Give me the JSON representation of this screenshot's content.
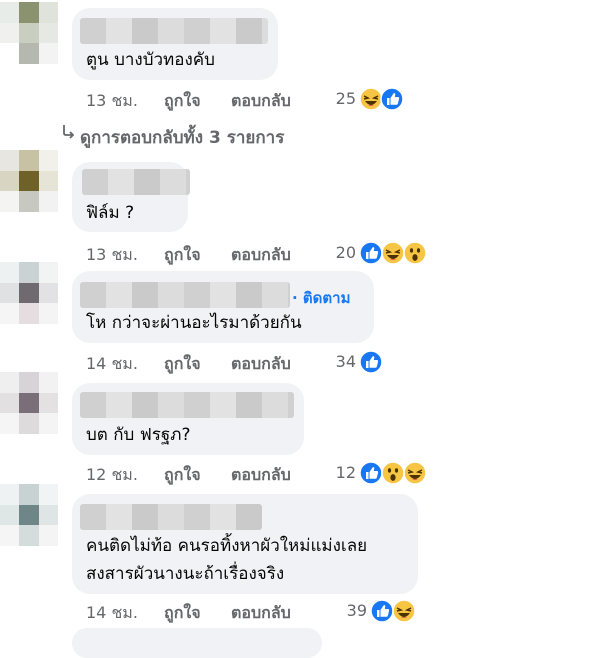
{
  "comments": [
    {
      "text": "ตูน บางบัวทองคับ",
      "time": "13 ชม.",
      "like": "ถูกใจ",
      "reply": "ตอบกลับ",
      "reactions_count": "25",
      "reactions": [
        "haha-icon",
        "like-icon"
      ]
    },
    {
      "text": "ฟิล์ม ?",
      "time": "13 ชม.",
      "like": "ถูกใจ",
      "reply": "ตอบกลับ",
      "reactions_count": "20",
      "reactions": [
        "like-icon",
        "haha-icon",
        "wow-icon"
      ]
    },
    {
      "text": "โห กว่าจะผ่านอะไรมาด้วยกัน",
      "follow": "· ติดตาม",
      "time": "14 ชม.",
      "like": "ถูกใจ",
      "reply": "ตอบกลับ",
      "reactions_count": "34",
      "reactions": [
        "like-icon"
      ]
    },
    {
      "text": "บต กับ ฟรฐภ?",
      "time": "12 ชม.",
      "like": "ถูกใจ",
      "reply": "ตอบกลับ",
      "reactions_count": "12",
      "reactions": [
        "like-icon",
        "wow-icon",
        "haha-icon"
      ]
    },
    {
      "text_line1": "คนติดไม่ท้อ คนรอทิ้งหาผัวใหม่แม่งเลย",
      "text_line2": "สงสารผัวนางนะถ้าเรื่องจริง",
      "time": "14 ชม.",
      "like": "ถูกใจ",
      "reply": "ตอบกลับ",
      "reactions_count": "39",
      "reactions": [
        "like-icon",
        "haha-icon"
      ]
    }
  ],
  "view_replies": "ดูการตอบกลับทั้ง 3 รายการ",
  "colors": {
    "like_blue": "#1877f2",
    "emoji_yellow": "#f7c544",
    "bubble": "#f0f2f5",
    "meta": "#65676b"
  }
}
